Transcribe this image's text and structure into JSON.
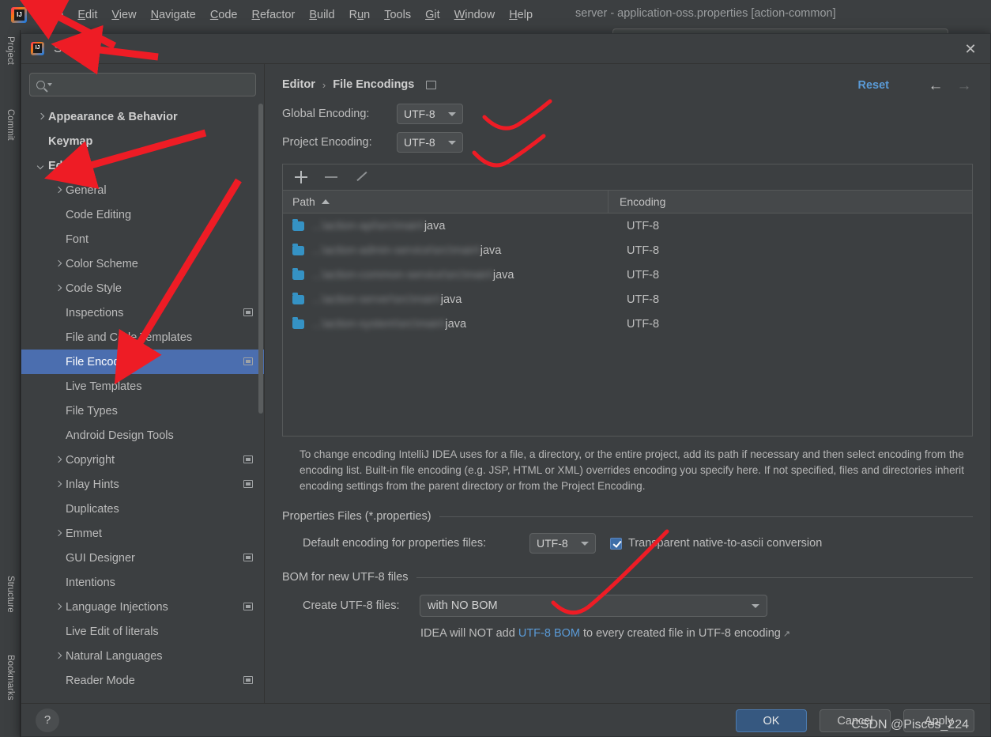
{
  "ide": {
    "title": "server - application-oss.properties [action-common]",
    "menu": [
      "File",
      "Edit",
      "View",
      "Navigate",
      "Code",
      "Refactor",
      "Build",
      "Run",
      "Tools",
      "Git",
      "Window",
      "Help"
    ],
    "menu_mnemonics": [
      "F",
      "E",
      "V",
      "N",
      "C",
      "R",
      "B",
      "R",
      "T",
      "G",
      "W",
      "H"
    ],
    "tool_tabs_left": [
      "Project",
      "Commit"
    ],
    "tool_tabs_left_bottom": [
      "Structure",
      "Bookmarks"
    ],
    "logo_icon": "intellij-idea-logo-icon"
  },
  "dialog": {
    "title": "Settings",
    "logo_icon": "intellij-idea-logo-icon",
    "close_icon": "close-icon"
  },
  "search": {
    "value": "",
    "placeholder": "",
    "icon": "search-icon",
    "caret_icon": "chevron-down-icon"
  },
  "nav": {
    "items": [
      {
        "label": "Appearance & Behavior",
        "indent": 0,
        "chevron": "right",
        "bold": true,
        "badge": false,
        "selected": false
      },
      {
        "label": "Keymap",
        "indent": 0,
        "chevron": "none",
        "bold": true,
        "badge": false,
        "selected": false
      },
      {
        "label": "Editor",
        "indent": 0,
        "chevron": "down",
        "bold": true,
        "badge": false,
        "selected": false
      },
      {
        "label": "General",
        "indent": 1,
        "chevron": "right",
        "bold": false,
        "badge": false,
        "selected": false
      },
      {
        "label": "Code Editing",
        "indent": 1,
        "chevron": "none",
        "bold": false,
        "badge": false,
        "selected": false
      },
      {
        "label": "Font",
        "indent": 1,
        "chevron": "none",
        "bold": false,
        "badge": false,
        "selected": false
      },
      {
        "label": "Color Scheme",
        "indent": 1,
        "chevron": "right",
        "bold": false,
        "badge": false,
        "selected": false
      },
      {
        "label": "Code Style",
        "indent": 1,
        "chevron": "right",
        "bold": false,
        "badge": false,
        "selected": false
      },
      {
        "label": "Inspections",
        "indent": 1,
        "chevron": "none",
        "bold": false,
        "badge": true,
        "selected": false
      },
      {
        "label": "File and Code Templates",
        "indent": 1,
        "chevron": "none",
        "bold": false,
        "badge": false,
        "selected": false
      },
      {
        "label": "File Encodings",
        "indent": 1,
        "chevron": "none",
        "bold": false,
        "badge": true,
        "selected": true
      },
      {
        "label": "Live Templates",
        "indent": 1,
        "chevron": "none",
        "bold": false,
        "badge": false,
        "selected": false
      },
      {
        "label": "File Types",
        "indent": 1,
        "chevron": "none",
        "bold": false,
        "badge": false,
        "selected": false
      },
      {
        "label": "Android Design Tools",
        "indent": 1,
        "chevron": "none",
        "bold": false,
        "badge": false,
        "selected": false
      },
      {
        "label": "Copyright",
        "indent": 1,
        "chevron": "right",
        "bold": false,
        "badge": true,
        "selected": false
      },
      {
        "label": "Inlay Hints",
        "indent": 1,
        "chevron": "right",
        "bold": false,
        "badge": true,
        "selected": false
      },
      {
        "label": "Duplicates",
        "indent": 1,
        "chevron": "none",
        "bold": false,
        "badge": false,
        "selected": false
      },
      {
        "label": "Emmet",
        "indent": 1,
        "chevron": "right",
        "bold": false,
        "badge": false,
        "selected": false
      },
      {
        "label": "GUI Designer",
        "indent": 1,
        "chevron": "none",
        "bold": false,
        "badge": true,
        "selected": false
      },
      {
        "label": "Intentions",
        "indent": 1,
        "chevron": "none",
        "bold": false,
        "badge": false,
        "selected": false
      },
      {
        "label": "Language Injections",
        "indent": 1,
        "chevron": "right",
        "bold": false,
        "badge": true,
        "selected": false
      },
      {
        "label": "Live Edit of literals",
        "indent": 1,
        "chevron": "none",
        "bold": false,
        "badge": false,
        "selected": false
      },
      {
        "label": "Natural Languages",
        "indent": 1,
        "chevron": "right",
        "bold": false,
        "badge": false,
        "selected": false
      },
      {
        "label": "Reader Mode",
        "indent": 1,
        "chevron": "none",
        "bold": false,
        "badge": true,
        "selected": false
      }
    ]
  },
  "pane": {
    "breadcrumb": [
      "Editor",
      "File Encodings"
    ],
    "breadcrumb_separator": "›",
    "breadcrumb_badge_icon": "project-scope-icon",
    "reset_label": "Reset",
    "back_icon": "arrow-left-icon",
    "forward_icon": "arrow-right-icon",
    "global_encoding": {
      "label": "Global Encoding:",
      "value": "UTF-8"
    },
    "project_encoding": {
      "label": "Project Encoding:",
      "value": "UTF-8"
    },
    "toolbar": {
      "add_icon": "plus-icon",
      "remove_icon": "minus-icon",
      "edit_icon": "pencil-icon"
    },
    "table": {
      "columns": [
        "Path",
        "Encoding"
      ],
      "sort_column": "Path",
      "sort_direction": "asc",
      "rows": [
        {
          "path_blurred": "...\\action-api\\src\\main\\",
          "path_tail": "java",
          "encoding": "UTF-8"
        },
        {
          "path_blurred": "...\\action-admin-service\\src\\main\\",
          "path_tail": "java",
          "encoding": "UTF-8"
        },
        {
          "path_blurred": "...\\action-common-service\\src\\main\\",
          "path_tail": "java",
          "encoding": "UTF-8"
        },
        {
          "path_blurred": "...\\action-server\\src\\main\\",
          "path_tail": "java",
          "encoding": "UTF-8"
        },
        {
          "path_blurred": "...\\action-system\\src\\main\\",
          "path_tail": "java",
          "encoding": "UTF-8"
        }
      ]
    },
    "description": "To change encoding IntelliJ IDEA uses for a file, a directory, or the entire project, add its path if necessary and then select encoding from the encoding list. Built-in file encoding (e.g. JSP, HTML or XML) overrides encoding you specify here. If not specified, files and directories inherit encoding settings from the parent directory or from the Project Encoding.",
    "properties_section": {
      "title": "Properties Files (*.properties)",
      "default_encoding_label": "Default encoding for properties files:",
      "default_encoding_value": "UTF-8",
      "transparent_label": "Transparent native-to-ascii conversion",
      "transparent_checked": true
    },
    "bom_section": {
      "title": "BOM for new UTF-8 files",
      "create_label": "Create UTF-8 files:",
      "create_value": "with NO BOM",
      "note_before": "IDEA will NOT add ",
      "note_link": "UTF-8 BOM",
      "note_after": " to every created file in UTF-8 encoding",
      "note_ext_icon": "external-link-icon"
    }
  },
  "footer": {
    "help_label": "?",
    "help_icon": "help-icon",
    "ok_label": "OK",
    "cancel_label": "Cancel",
    "apply_label": "Apply"
  },
  "watermark": "CSDN @Pisces_224",
  "colors": {
    "background": "#3c3f41",
    "selection": "#4b6eaf",
    "link": "#5a9bd8",
    "folder": "#3592c4",
    "annotation": "#ee1c25",
    "ok_button": "#365880"
  }
}
